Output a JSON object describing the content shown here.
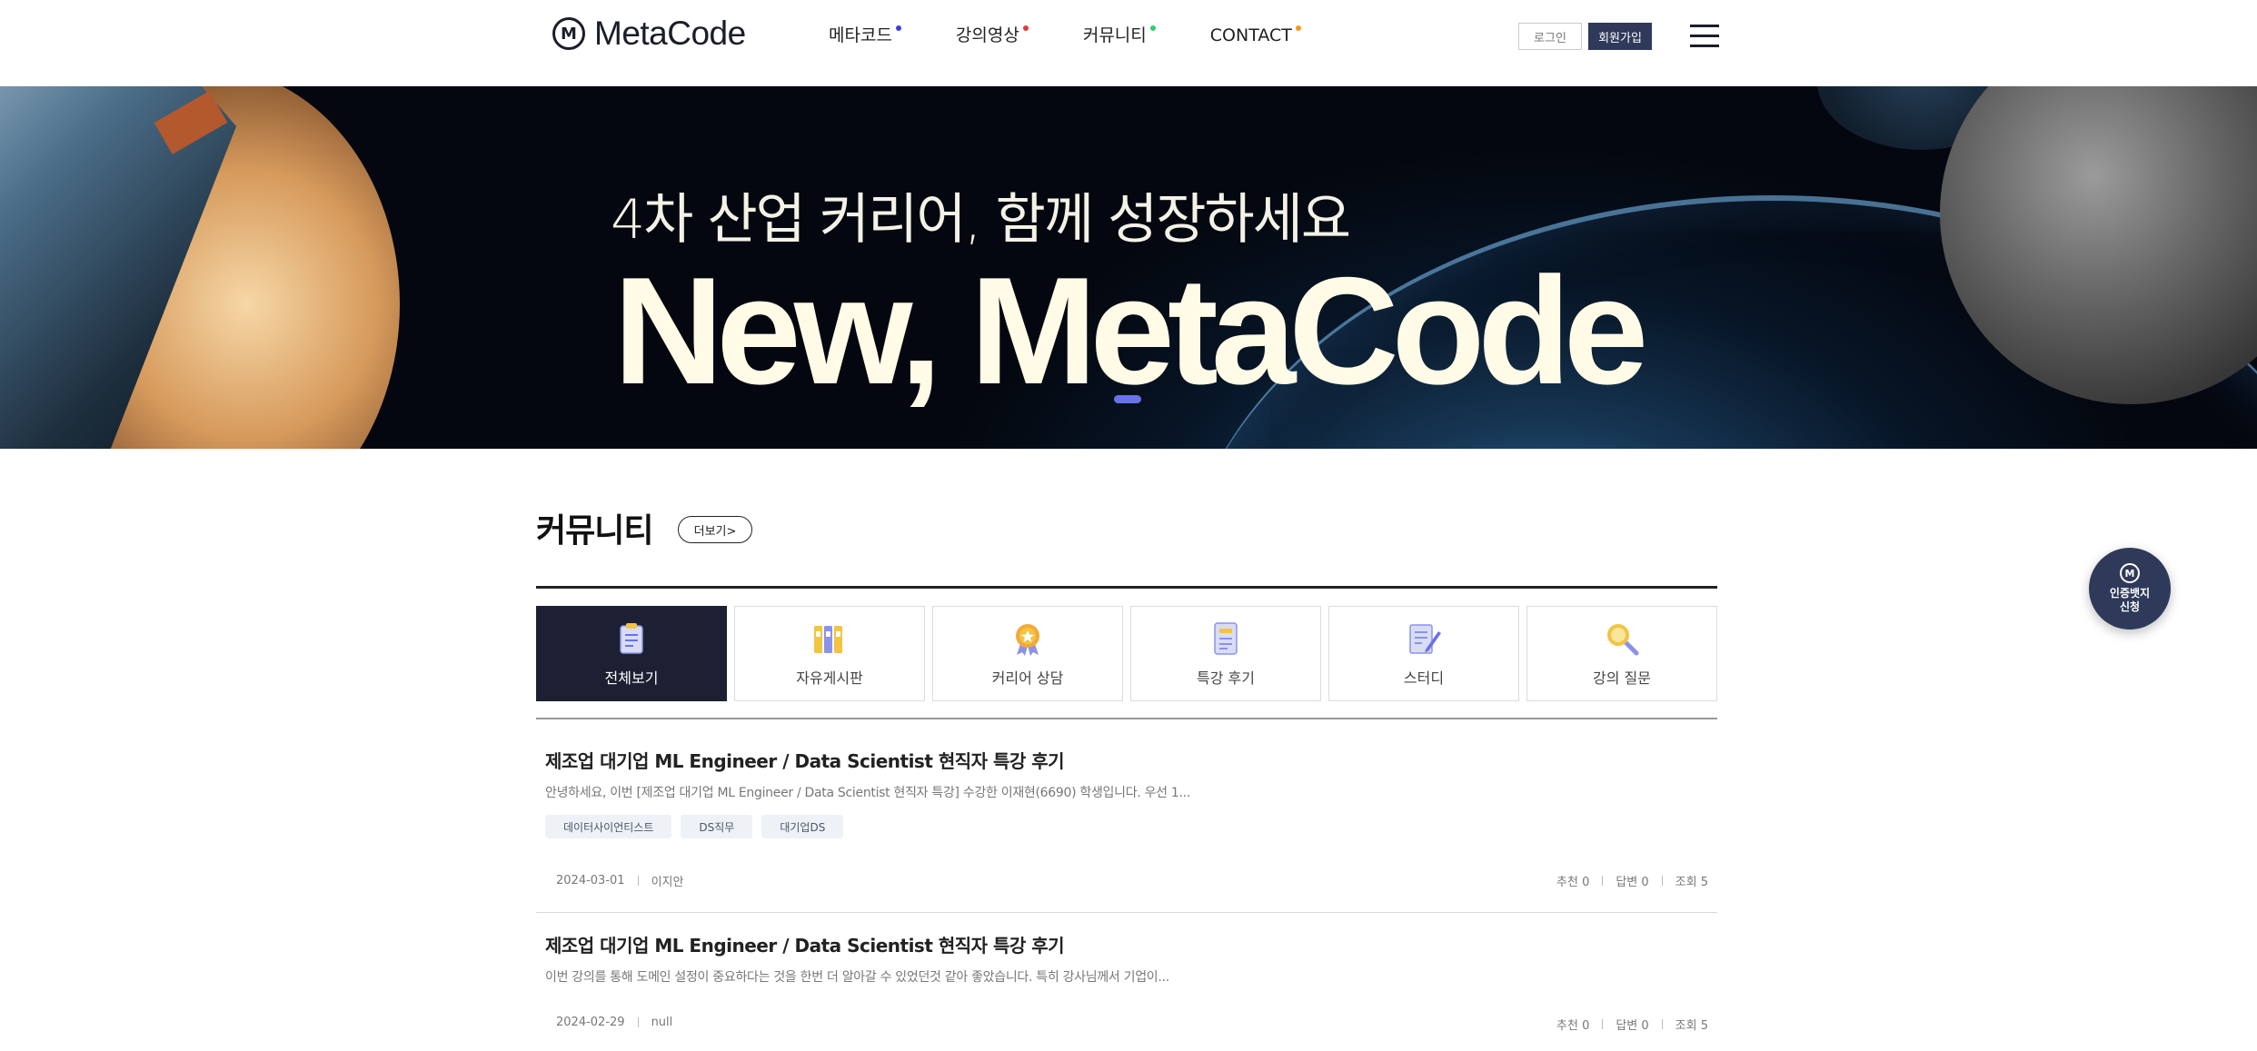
{
  "header": {
    "logo_mark": "M",
    "logo_text": "MetaCode",
    "nav": [
      {
        "label": "메타코드",
        "dot_color": "#3b3fe0"
      },
      {
        "label": "강의영상",
        "dot_color": "#e53935"
      },
      {
        "label": "커뮤니티",
        "dot_color": "#2ecc71"
      },
      {
        "label": "CONTACT",
        "dot_color": "#f39c12"
      }
    ],
    "login_label": "로그인",
    "join_label": "회원가입",
    "menu_icon": "hamburger-icon"
  },
  "hero": {
    "subtitle": "4차 산업 커리어, 함께 성장하세요",
    "title": "New, MetaCode"
  },
  "community": {
    "title": "커뮤니티",
    "more_label": "더보기>",
    "categories": [
      {
        "label": "전체보기",
        "icon": "clipboard-icon",
        "active": true
      },
      {
        "label": "자유게시판",
        "icon": "binders-icon",
        "active": false
      },
      {
        "label": "커리어 상담",
        "icon": "award-medal-icon",
        "active": false
      },
      {
        "label": "특강 후기",
        "icon": "document-icon",
        "active": false
      },
      {
        "label": "스터디",
        "icon": "note-pencil-icon",
        "active": false
      },
      {
        "label": "강의 질문",
        "icon": "magnifier-icon",
        "active": false
      }
    ],
    "posts": [
      {
        "title": "제조업 대기업 ML Engineer / Data Scientist 현직자 특강 후기",
        "excerpt": "안녕하세요, 이번 [제조업 대기업 ML Engineer / Data Scientist 현직자 특강] 수강한 이재현(6690) 학생입니다. 우선 1...",
        "tags": [
          "데이터사이언티스트",
          "DS직무",
          "대기업DS"
        ],
        "date": "2024-03-01",
        "author": "이지안",
        "likes": "추천 0",
        "answers": "답변 0",
        "views": "조회 5"
      },
      {
        "title": "제조업 대기업 ML Engineer / Data Scientist 현직자 특강 후기",
        "excerpt": "이번 강의를 통해 도메인 설정이 중요하다는 것을 한번 더 알아갈 수 있었던것 같아 좋았습니다.  특히 강사님께서 기업이...",
        "tags": [],
        "date": "2024-02-29",
        "author": "null",
        "likes": "추천 0",
        "answers": "답변 0",
        "views": "조회 5"
      }
    ]
  },
  "fab": {
    "mark": "M",
    "label": "인증뱃지\n신청"
  }
}
